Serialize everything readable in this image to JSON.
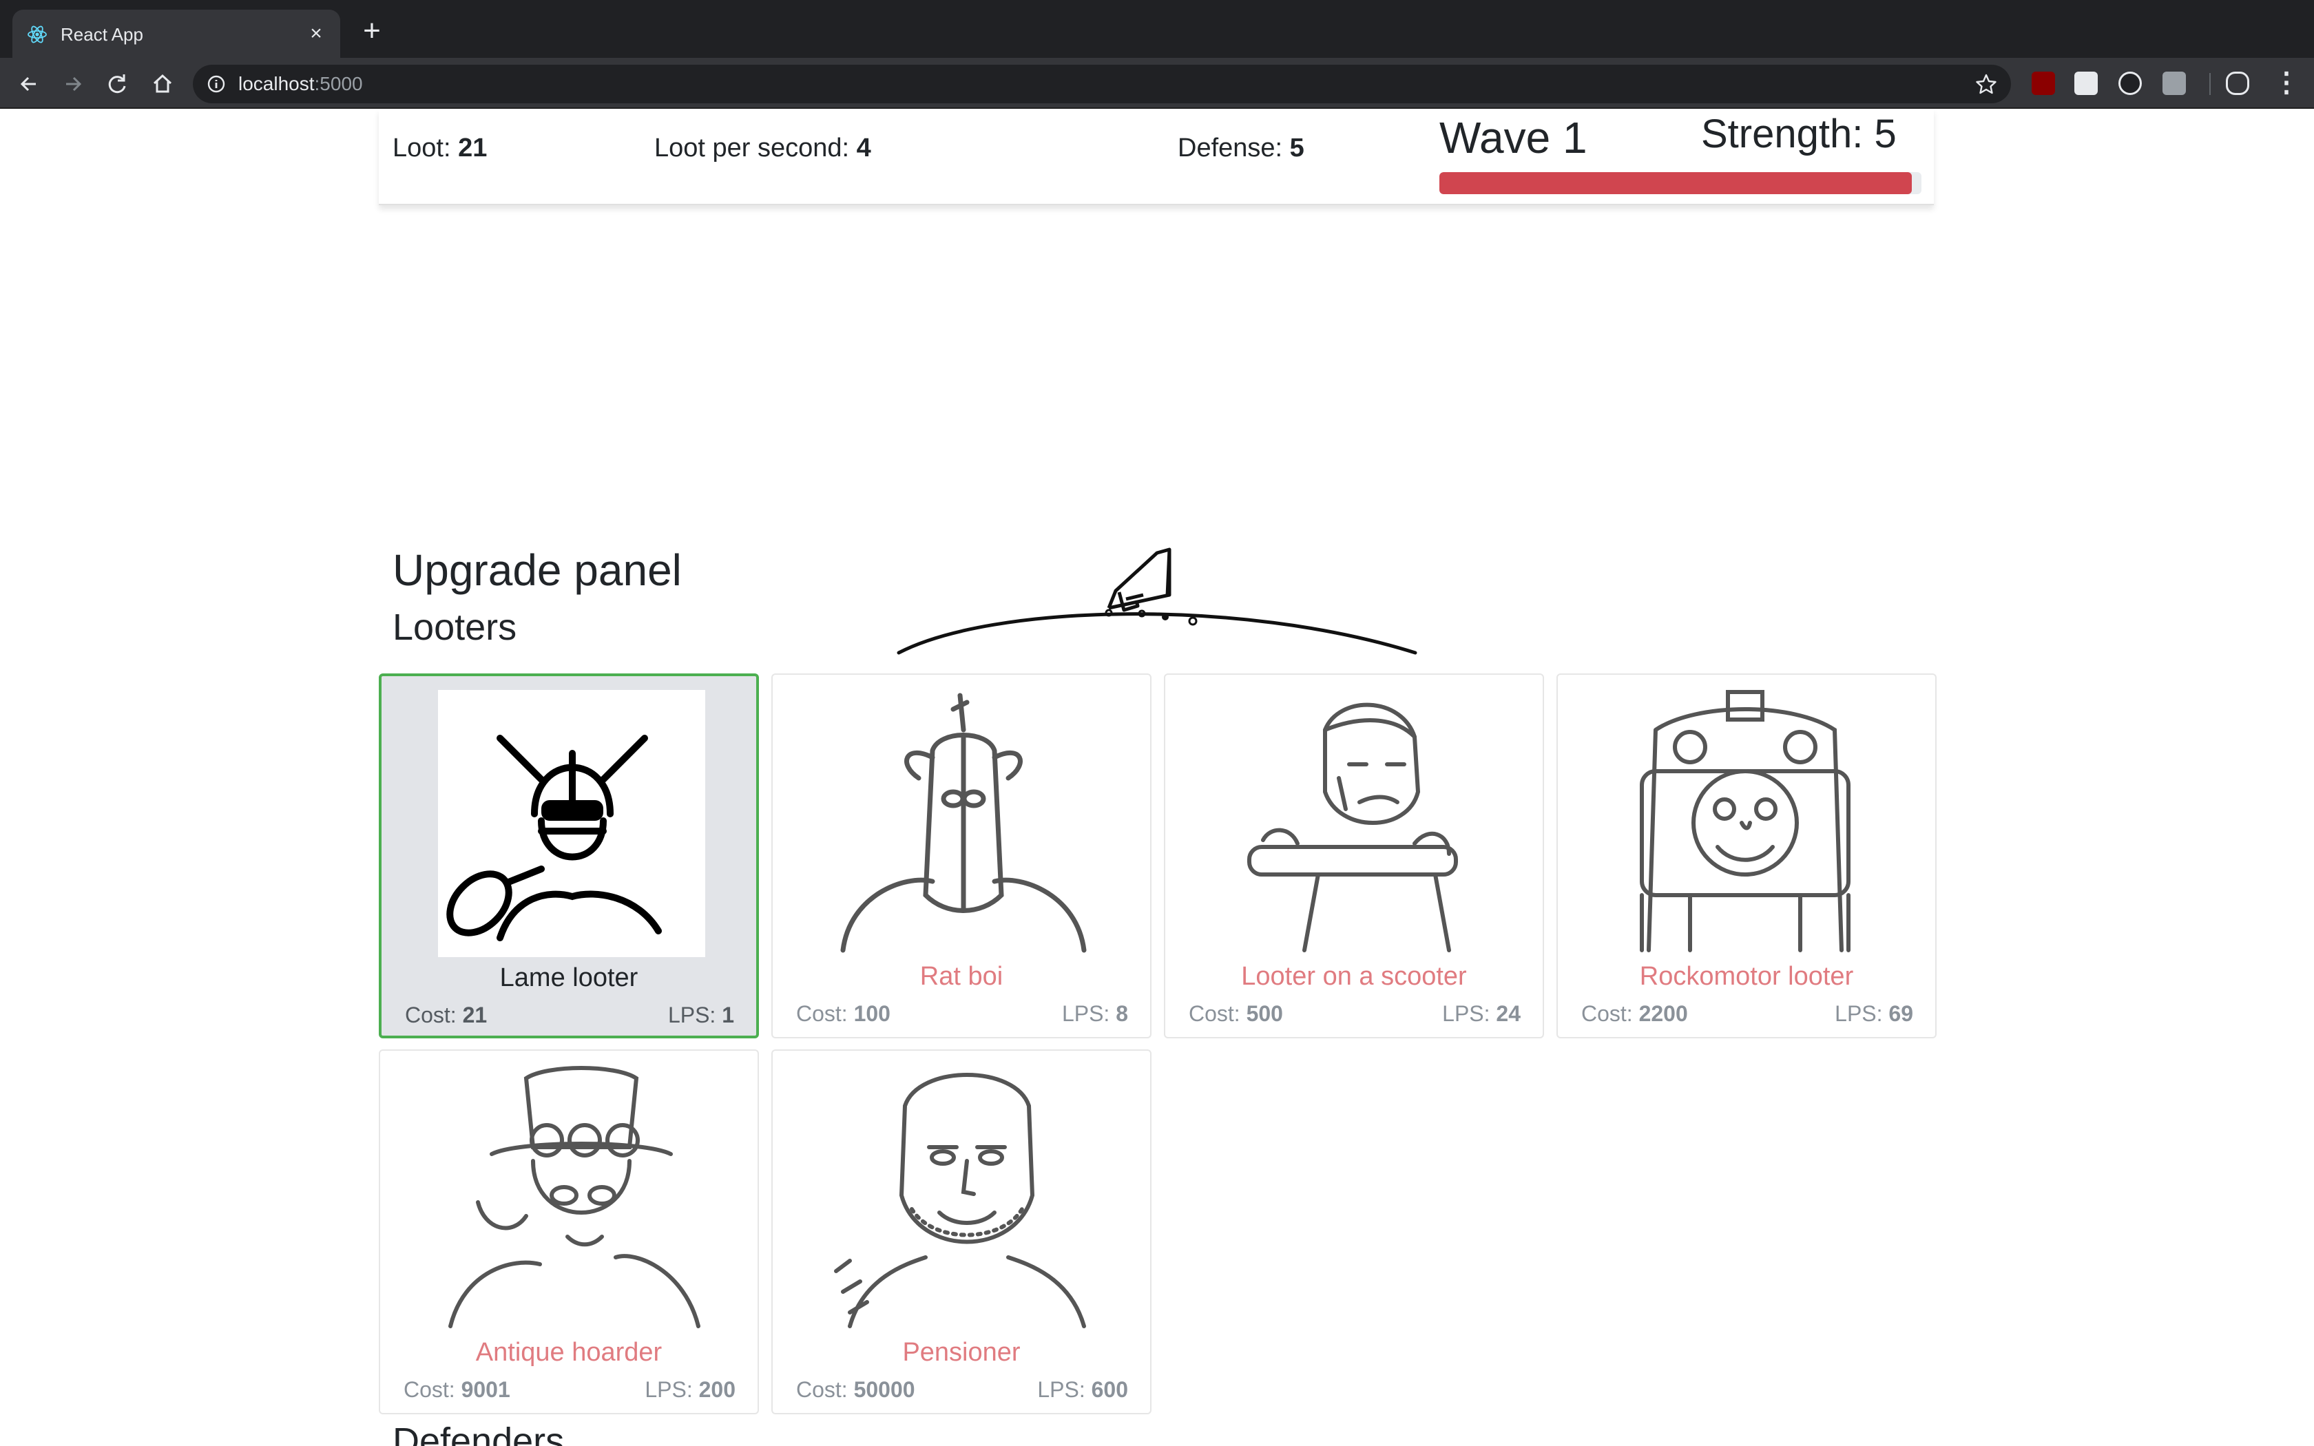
{
  "browser": {
    "tab_title": "React App",
    "url_host": "localhost",
    "url_port": ":5000"
  },
  "stats": {
    "loot_label": "Loot: ",
    "loot_value": "21",
    "lps_label": "Loot per second: ",
    "lps_value": "4",
    "defense_label": "Defense: ",
    "defense_value": "5",
    "wave_title": "Wave 1",
    "strength_label": "Strength: ",
    "strength_value": "5",
    "wave_progress": 0.98,
    "progress_color": "#d0454f"
  },
  "upgrade_panel": {
    "title": "Upgrade panel",
    "looters_title": "Looters",
    "defenders_title": "Defenders",
    "cost_label": "Cost: ",
    "lps_label": "LPS: ",
    "looters": [
      {
        "name": "Lame looter",
        "cost": "21",
        "lps": "1",
        "selected": true,
        "icon": "viking-helmet-looter-icon"
      },
      {
        "name": "Rat boi",
        "cost": "100",
        "lps": "8",
        "selected": false,
        "icon": "hooded-rat-icon"
      },
      {
        "name": "Looter on a scooter",
        "cost": "500",
        "lps": "24",
        "selected": false,
        "icon": "scooter-man-icon"
      },
      {
        "name": "Rockomotor looter",
        "cost": "2200",
        "lps": "69",
        "selected": false,
        "icon": "tank-engine-icon"
      },
      {
        "name": "Antique hoarder",
        "cost": "9001",
        "lps": "200",
        "selected": false,
        "icon": "top-hat-steampunk-icon"
      },
      {
        "name": "Pensioner",
        "cost": "50000",
        "lps": "600",
        "selected": false,
        "icon": "old-man-icon"
      }
    ]
  },
  "colors": {
    "selected_border": "#4caf50",
    "unaffordable_name": "#e07b80"
  }
}
